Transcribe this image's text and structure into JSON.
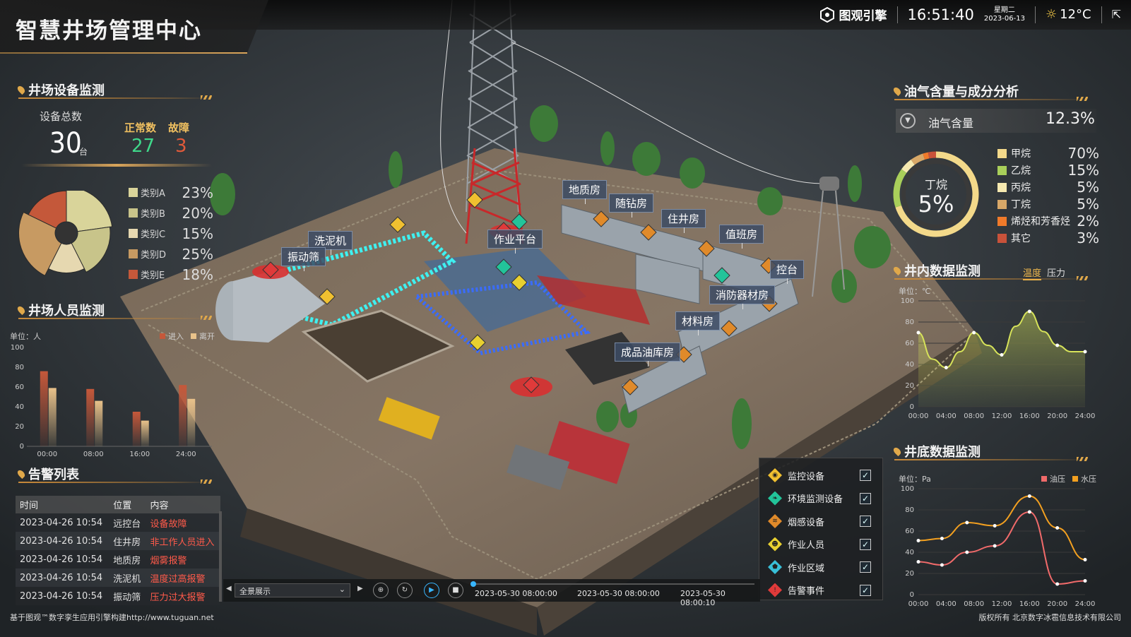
{
  "header": {
    "title": "智慧井场管理中心",
    "brand": "图观引擎",
    "time": "16:51:40",
    "weekday": "星期二",
    "date": "2023-06-13",
    "temperature": "12°C"
  },
  "equipment": {
    "title": "井场设备监测",
    "total_label": "设备总数",
    "total": "30",
    "unit": "台",
    "normal_label": "正常数",
    "normal": "27",
    "fault_label": "故障",
    "fault": "3",
    "categories": [
      {
        "name": "类别A",
        "value": "23%",
        "pct": 23,
        "color": "#d9d49a"
      },
      {
        "name": "类别B",
        "value": "20%",
        "pct": 20,
        "color": "#c8c48a"
      },
      {
        "name": "类别C",
        "value": "15%",
        "pct": 15,
        "color": "#e6d8b0"
      },
      {
        "name": "类别D",
        "value": "25%",
        "pct": 25,
        "color": "#c79a62"
      },
      {
        "name": "类别E",
        "value": "18%",
        "pct": 18,
        "color": "#c4583a"
      }
    ]
  },
  "personnel": {
    "title": "井场人员监测",
    "unit_label": "单位：人",
    "legend_in": "进入",
    "legend_out": "离开"
  },
  "alarms": {
    "title": "告警列表",
    "headers": [
      "时间",
      "位置",
      "内容"
    ],
    "rows": [
      [
        "2023-04-26 10:54",
        "远控台",
        "设备故障"
      ],
      [
        "2023-04-26 10:54",
        "住井房",
        "非工作人员进入"
      ],
      [
        "2023-04-26 10:54",
        "地质房",
        "烟雾报警"
      ],
      [
        "2023-04-26 10:54",
        "洗泥机",
        "温度过高报警"
      ],
      [
        "2023-04-26 10:54",
        "振动筛",
        "压力过大报警"
      ]
    ]
  },
  "gas": {
    "title": "油气含量与成分分析",
    "content_label": "油气含量",
    "content_value": "12.3%",
    "center_label": "丁烷",
    "center_value": "5%",
    "components": [
      {
        "name": "甲烷",
        "value": "70%",
        "color": "#f3d98a"
      },
      {
        "name": "乙烷",
        "value": "15%",
        "color": "#a9cf5a"
      },
      {
        "name": "丙烷",
        "value": "5%",
        "color": "#f6e9b0"
      },
      {
        "name": "丁烷",
        "value": "5%",
        "color": "#d8a868"
      },
      {
        "name": "烯烃和芳香烃",
        "value": "2%",
        "color": "#f07a2a"
      },
      {
        "name": "其它",
        "value": "3%",
        "color": "#c8523a"
      }
    ]
  },
  "well_inside": {
    "title": "井内数据监测",
    "tab_temp": "温度",
    "tab_pressure": "压力",
    "unit_label": "单位：℃"
  },
  "well_bottom": {
    "title": "井底数据监测",
    "unit_label": "单位：Pa",
    "legend_oil": "油压",
    "legend_water": "水压"
  },
  "scene_labels": {
    "dizhi": "地质房",
    "suizuan": "随钻房",
    "zhujing": "住井房",
    "zhiban": "值班房",
    "kongtai": "控台",
    "xiaofang": "消防器材房",
    "cailiao": "材料房",
    "chengpin": "成品油库房",
    "xini": "洗泥机",
    "zhendong": "振动筛",
    "pingtai": "作业平台"
  },
  "layers": [
    {
      "name": "监控设备",
      "checked": true,
      "color": "#f0c030",
      "icon": "camera-icon"
    },
    {
      "name": "环境监测设备",
      "checked": true,
      "color": "#22c49a",
      "icon": "leaf-icon"
    },
    {
      "name": "烟感设备",
      "checked": true,
      "color": "#e08a2a",
      "icon": "smoke-icon"
    },
    {
      "name": "作业人员",
      "checked": true,
      "color": "#e8d030",
      "icon": "person-icon"
    },
    {
      "name": "作业区域",
      "checked": true,
      "color": "#38c0d8",
      "icon": "area-icon"
    },
    {
      "name": "告警事件",
      "checked": true,
      "color": "#e03a3a",
      "icon": "alert-icon"
    }
  ],
  "timeline": {
    "mode": "全景展示",
    "times": [
      "2023-05-30 08:00:00",
      "2023-05-30 08:00:00",
      "2023-05-30 08:00:10"
    ]
  },
  "footer": {
    "left": "基于图观™数字孪生应用引擎构建http://www.tuguan.net",
    "right": "版权所有 北京数字冰雹信息技术有限公司"
  },
  "chart_data": [
    {
      "type": "pie",
      "title": "",
      "categories": [
        "类别A",
        "类别B",
        "类别C",
        "类别D",
        "类别E"
      ],
      "values": [
        23,
        20,
        15,
        25,
        18
      ]
    },
    {
      "type": "bar",
      "title": "",
      "ylabel": "单位：人",
      "categories": [
        "00:00",
        "08:00",
        "16:00",
        "24:00"
      ],
      "series": [
        {
          "name": "进入",
          "values": [
            76,
            58,
            35,
            62
          ]
        },
        {
          "name": "离开",
          "values": [
            59,
            46,
            26,
            48
          ]
        }
      ],
      "ylim": [
        0,
        100
      ],
      "yticks": [
        0,
        20,
        40,
        60,
        80,
        100
      ]
    },
    {
      "type": "line",
      "title": "",
      "ylabel": "单位：℃",
      "x": [
        "00:00",
        "04:00",
        "08:00",
        "12:00",
        "16:00",
        "20:00",
        "24:00"
      ],
      "x_num": [
        0,
        4,
        8,
        12,
        16,
        20,
        24
      ],
      "series": [
        {
          "name": "温度",
          "x": [
            0,
            2,
            4,
            6,
            8,
            10,
            12,
            14,
            16,
            18,
            20,
            22,
            24
          ],
          "values": [
            70,
            45,
            37,
            52,
            70,
            58,
            49,
            76,
            90,
            71,
            58,
            52,
            52
          ]
        }
      ],
      "ylim": [
        0,
        100
      ],
      "yticks": [
        0,
        20,
        40,
        60,
        80,
        100
      ]
    },
    {
      "type": "line",
      "title": "",
      "ylabel": "单位：Pa",
      "x": [
        "00:00",
        "04:00",
        "08:00",
        "12:00",
        "16:00",
        "20:00",
        "24:00"
      ],
      "x_num": [
        0,
        4,
        8,
        12,
        16,
        20,
        24
      ],
      "series": [
        {
          "name": "油压",
          "x": [
            0,
            3.4,
            7,
            11,
            16,
            20,
            24
          ],
          "values": [
            31,
            28,
            40,
            46,
            78,
            10,
            13
          ]
        },
        {
          "name": "水压",
          "x": [
            0,
            3.4,
            7,
            11,
            16,
            20,
            24
          ],
          "values": [
            51,
            53,
            68,
            65,
            93,
            63,
            33
          ]
        }
      ],
      "ylim": [
        0,
        100
      ],
      "yticks": [
        0,
        20,
        40,
        60,
        80,
        100
      ]
    }
  ]
}
